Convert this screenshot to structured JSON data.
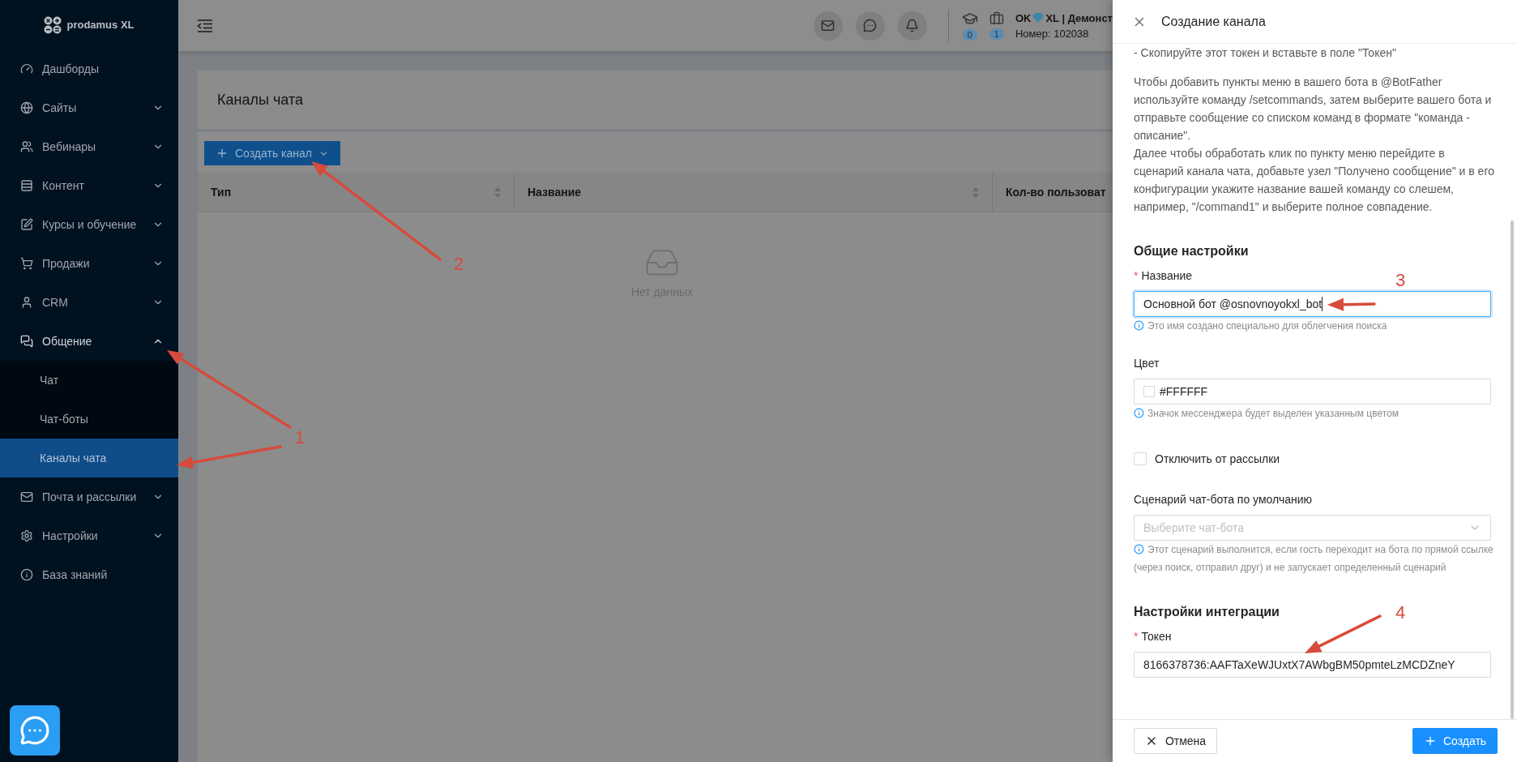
{
  "sidebar": {
    "logo": "prodamus XL",
    "items": [
      {
        "label": "Дашборды"
      },
      {
        "label": "Сайты",
        "expanded": false
      },
      {
        "label": "Вебинары",
        "expanded": false
      },
      {
        "label": "Контент",
        "expanded": false
      },
      {
        "label": "Курсы и обучение",
        "expanded": false
      },
      {
        "label": "Продажи",
        "expanded": false
      },
      {
        "label": "CRM",
        "expanded": false
      },
      {
        "label": "Общение",
        "expanded": true,
        "children": [
          {
            "label": "Чат",
            "selected": false
          },
          {
            "label": "Чат-боты",
            "selected": false
          },
          {
            "label": "Каналы чата",
            "selected": true
          }
        ]
      },
      {
        "label": "Почта и рассылки",
        "expanded": false
      },
      {
        "label": "Настройки",
        "expanded": false
      },
      {
        "label": "База знаний"
      }
    ]
  },
  "header": {
    "badges": [
      "0",
      "1"
    ],
    "account_prefix": "OK",
    "account_rest": "XL | Демонст",
    "number": "Номер: 102038"
  },
  "page": {
    "title": "Каналы чата",
    "create_button": "Создать канал",
    "table": {
      "columns": [
        {
          "label": "Тип",
          "sortable": true
        },
        {
          "label": "Название",
          "sortable": true
        },
        {
          "label": "Кол-во пользоват",
          "sortable": false
        }
      ],
      "empty_text": "Нет данных"
    }
  },
  "drawer": {
    "title": "Создание канала",
    "instructions": [
      [
        "- Скопируйте этот токен и вставьте в поле \"Токен\""
      ],
      [
        "Чтобы добавить пункты меню в вашего бота в @BotFather используйте команду /setcommands, затем выберите вашего бота и отправьте сообщение со списком команд в формате \"команда - описание\".",
        "Далее чтобы обработать клик по пункту меню перейдите в сценарий канала чата, добавьте узел \"Получено сообщение\" и в его конфигурации укажите название вашей команду со слешем, например, \"/command1\" и выберите полное совпадение."
      ]
    ],
    "sections": [
      {
        "title": "Общие настройки",
        "fields": [
          {
            "kind": "input",
            "label": "Название",
            "required_mark": "*",
            "value": "Основной бот @osnovnoyokxl_bot",
            "focused": true,
            "hint": "Это имя создано специально для облегчения поиска"
          },
          {
            "kind": "color",
            "label": "Цвет",
            "value": "#FFFFFF",
            "hint": "Значок мессенджера будет выделен указанным цветом"
          },
          {
            "kind": "checkbox",
            "label": "Отключить от рассылки",
            "checked": false
          },
          {
            "kind": "select",
            "label": "Сценарий чат-бота по умолчанию",
            "placeholder": "Выберите чат-бота",
            "hint": "Этот сценарий выполнится, если гость переходит на бота по прямой ссылке (через поиск, отправил друг) и не запускает определенный сценарий"
          }
        ]
      },
      {
        "title": "Настройки интеграции",
        "fields": [
          {
            "kind": "input",
            "label": "Токен",
            "required_mark": "*",
            "value": "8166378736:AAFTaXeWJUxtX7AWbgBM50pmteLzMCDZneY",
            "focused": false
          }
        ]
      }
    ],
    "cancel_button": "Отмена",
    "submit_button": "Создать"
  },
  "annotations": [
    {
      "label": "1"
    },
    {
      "label": "2"
    },
    {
      "label": "3"
    },
    {
      "label": "4"
    }
  ]
}
